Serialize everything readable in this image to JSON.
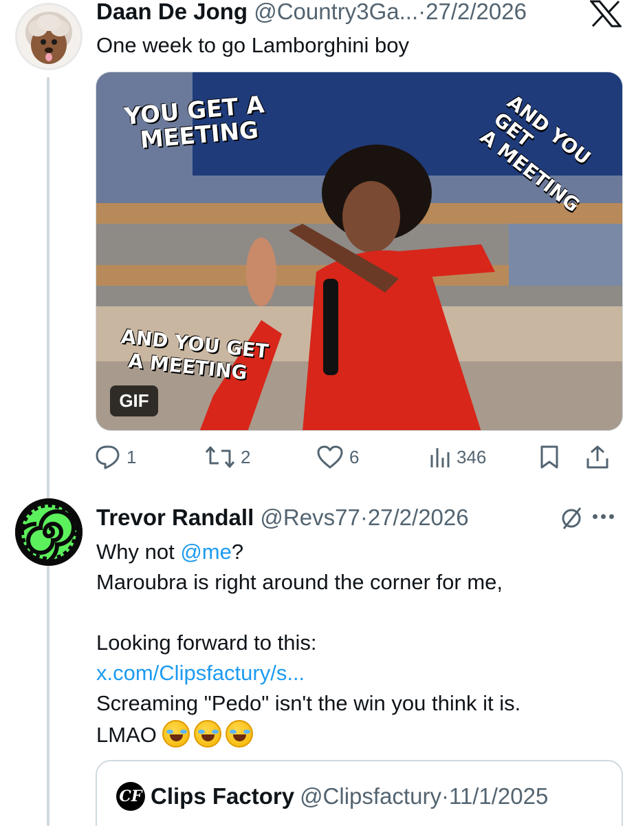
{
  "tweet1": {
    "name": "Daan De Jong",
    "handle": "@Country3Ga...",
    "separator": "·",
    "date": "27/2/2026",
    "text": "One week to go Lamborghini boy",
    "media": {
      "badge": "GIF",
      "caption_top_left_1": "YOU GET A",
      "caption_top_left_2": "MEETING",
      "caption_right_1": "AND YOU GET",
      "caption_right_2": "A MEETING",
      "caption_bottom_1": "AND YOU GET",
      "caption_bottom_2": "A MEETING"
    },
    "actions": {
      "replies": "1",
      "reposts": "2",
      "likes": "6",
      "views": "346"
    }
  },
  "tweet2": {
    "name": "Trevor Randall",
    "handle": "@Revs77",
    "separator": "·",
    "date": "27/2/2026",
    "line1_prefix": "Why not ",
    "line1_mention": "@me",
    "line1_suffix": "?",
    "line2": "Maroubra is right around the corner for me,",
    "line3": "Looking forward to this:",
    "link": "x.com/Clipsfactury/s...",
    "line5": "Screaming \"Pedo\" isn't the win you think it is.",
    "line6": "LMAO"
  },
  "quote": {
    "logo_text": "CF",
    "name": "Clips Factory",
    "handle": "@Clipsfactury",
    "separator": "·",
    "date": "11/1/2025"
  },
  "icons": {
    "close": "x-logo-icon",
    "reply": "reply-icon",
    "repost": "repost-icon",
    "like": "heart-icon",
    "views": "views-icon",
    "bookmark": "bookmark-icon",
    "share": "share-icon",
    "grok": "grok-icon",
    "more": "more-icon"
  },
  "colors": {
    "link": "#1d9bf0",
    "secondary": "#536471",
    "text": "#0f1419",
    "gif_dress": "#d8261a",
    "gif_screen": "#1f3b7a",
    "avatar2_green": "#5cf05c"
  }
}
